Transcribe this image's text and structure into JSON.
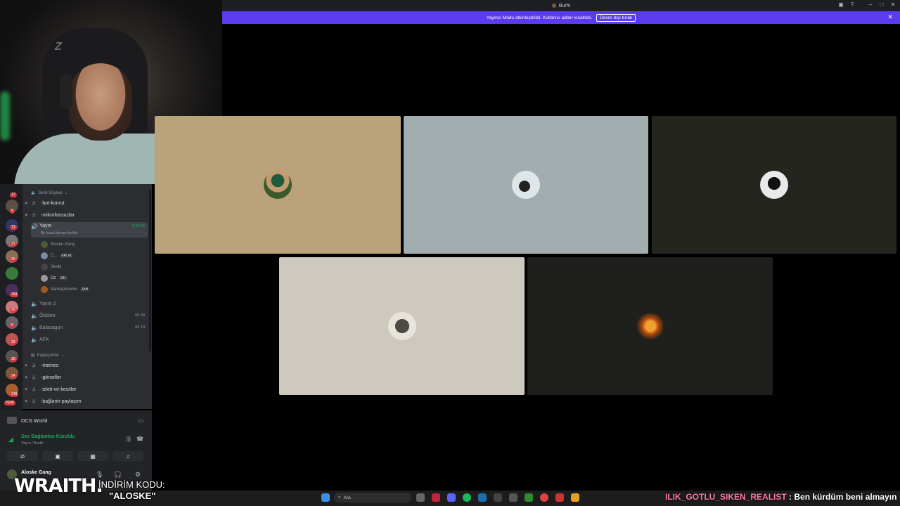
{
  "window": {
    "title": "Burhi"
  },
  "banner": {
    "text": "Yayıncı Modu etkinleştirildi. Kullanıcı adları kısaltıldı.",
    "button": "Devre dışı bırak"
  },
  "channels": {
    "category_voice": "Sesli Söyleşi",
    "text_channels": [
      "-bot-komut",
      "-mikrofonsuzlar"
    ],
    "voice_selected": {
      "name": "Yayın",
      "time": "3:20:02",
      "status": "Bir kanal durumu belirle"
    },
    "voice_users": [
      {
        "name": "Aloske Gang",
        "tag": ""
      },
      {
        "name": "C...",
        "tag": "ERLIK"
      },
      {
        "name": "Jewbi",
        "tag": ""
      },
      {
        "name": "Oz",
        "tag": "181"
      },
      {
        "name": "trankaphoenix",
        "tag": "JAH"
      }
    ],
    "voice_channels": [
      {
        "name": "Yayın 2",
        "count": ""
      },
      {
        "name": "Ötüken",
        "count": "00 99"
      },
      {
        "name": "Balasagun",
        "count": "00 10"
      },
      {
        "name": "AFK",
        "count": ""
      }
    ],
    "category_share": "Paylaşımlar",
    "share_channels": [
      "-memes",
      "-görseller",
      "-izleti-ve-kesitler",
      "-bağlantı-paylaşım"
    ]
  },
  "server_badges": [
    "17",
    "6",
    "71",
    "21",
    "99",
    "193",
    "20",
    "8",
    "29",
    "30",
    "24",
    "248",
    "YENİ"
  ],
  "activity": {
    "label": "DCS World"
  },
  "voice_panel": {
    "title": "Ses Bağlantısı Kuruldu",
    "subtitle": "Yayın / Burhi"
  },
  "user_panel": {
    "name": "Aloske Gang"
  },
  "taskbar": {
    "search_placeholder": "Ara"
  },
  "overlay": {
    "brand": "WRAITH.",
    "promo_line1": "İNDİRİM KODU:",
    "promo_line2": "\"ALOSKE\"",
    "chat_user": "ILIK_GOTLU_SIKEN_REALIST",
    "chat_message": ": Ben kürdüm beni almayın"
  },
  "colors": {
    "accent_banner": "#5b3bf0",
    "voice_connected": "#23a55a",
    "tile1": "#baa27b",
    "tile2": "#a2adb0",
    "tile3": "#25251f",
    "tile4": "#cec9bf",
    "tile5": "#1f201b"
  }
}
